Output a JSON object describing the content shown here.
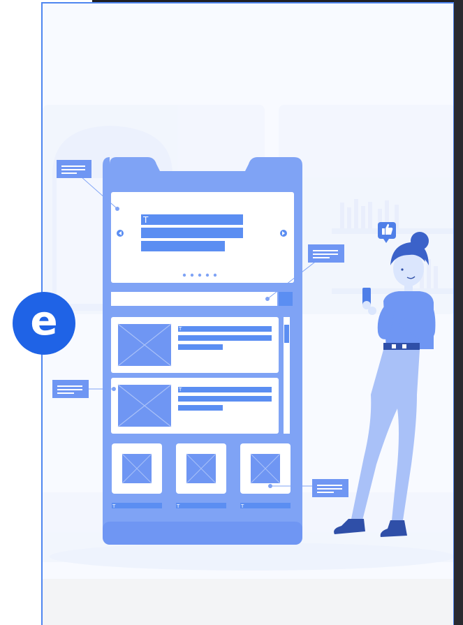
{
  "brand": {
    "badge_letter": "e",
    "badge_color": "#1f63e6"
  },
  "mockup": {
    "text_marker": "T",
    "carousel_dot_count": 5
  },
  "colors": {
    "frame": "#7fa3f5",
    "panel": "#ffffff",
    "accent": "#5b8ef2",
    "light": "#c9d9fb",
    "border": "#4f86f0"
  }
}
